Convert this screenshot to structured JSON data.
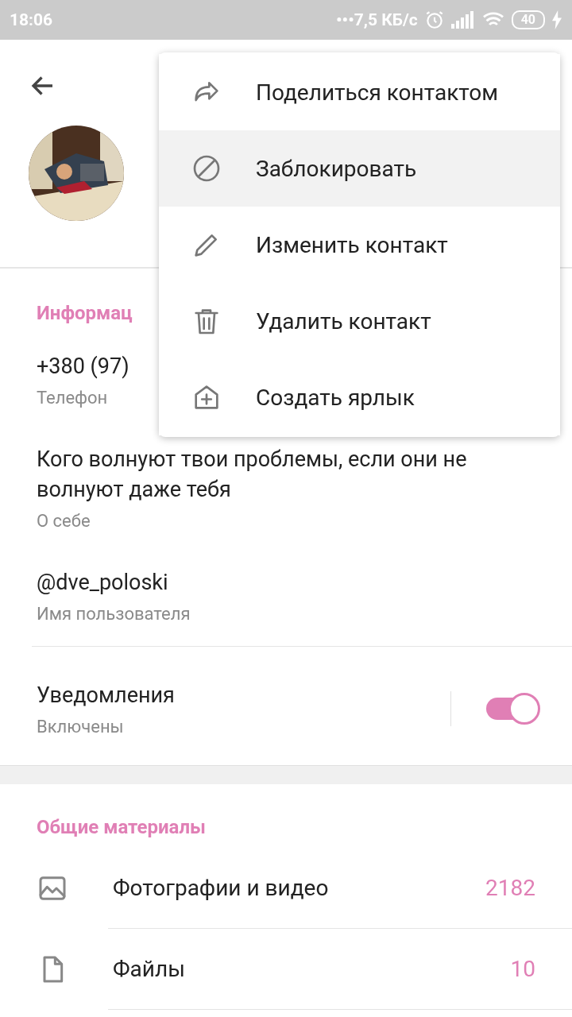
{
  "status_bar": {
    "time": "18:06",
    "speed": "•••7,5 КБ/с",
    "battery": "40"
  },
  "info": {
    "title": "Информац",
    "phone": "+380 (97)",
    "phone_label": "Телефон",
    "bio": "Кого волнуют твои проблемы, если они не волнуют даже тебя",
    "bio_label": "О себе",
    "username": "@dve_poloski",
    "username_label": "Имя пользователя",
    "notifications": {
      "label": "Уведомления",
      "value": "Включены",
      "on": true
    }
  },
  "shared": {
    "title": "Общие материалы",
    "items": [
      {
        "kind": "media",
        "label": "Фотографии и видео",
        "count": "2182"
      },
      {
        "kind": "file",
        "label": "Файлы",
        "count": "10"
      }
    ]
  },
  "menu": {
    "items": [
      {
        "kind": "share",
        "label": "Поделиться контактом",
        "selected": false
      },
      {
        "kind": "block",
        "label": "Заблокировать",
        "selected": true
      },
      {
        "kind": "edit",
        "label": "Изменить контакт",
        "selected": false
      },
      {
        "kind": "delete",
        "label": "Удалить контакт",
        "selected": false
      },
      {
        "kind": "shortcut",
        "label": "Создать ярлык",
        "selected": false
      }
    ]
  }
}
